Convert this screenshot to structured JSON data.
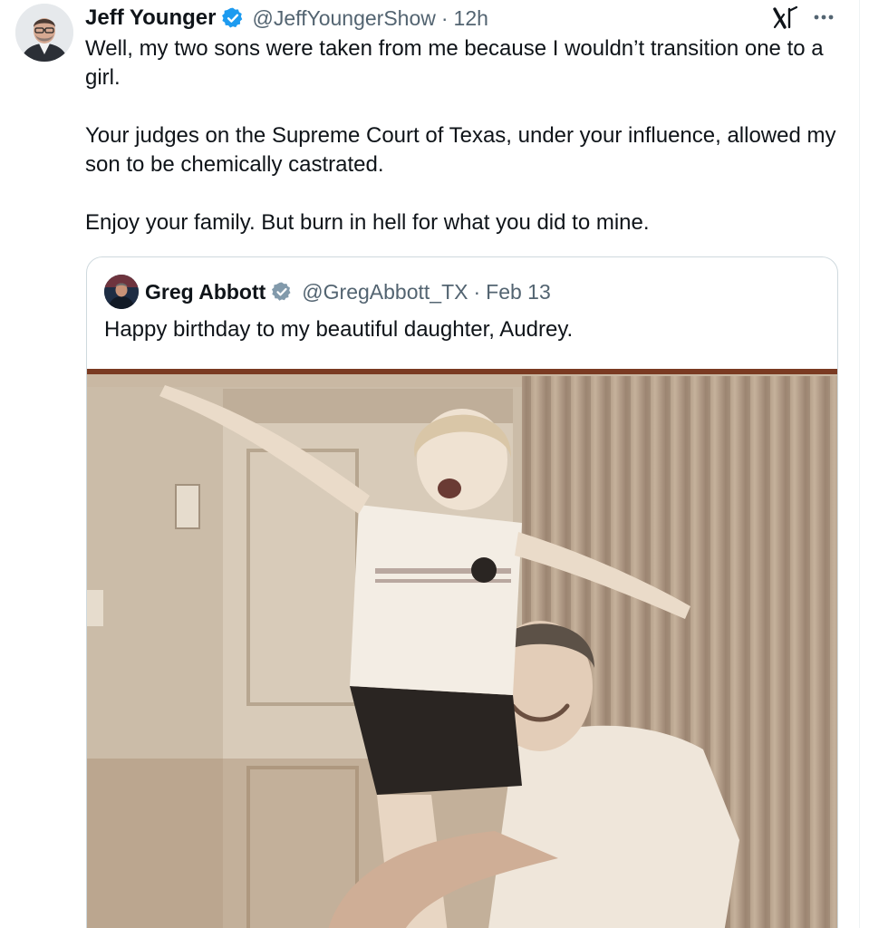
{
  "tweet": {
    "author_name": "Jeff Younger",
    "handle": "@JeffYoungerShow",
    "separator": "·",
    "time": "12h",
    "paragraphs": [
      "Well, my two sons were taken from me because I wouldn’t transition one to a girl.",
      "Your judges on the Supreme Court of Texas, under your influence, allowed my son to be chemically castrated.",
      "Enjoy your family. But burn in hell for what you did to mine."
    ],
    "icons": {
      "verified": "verified-badge-icon",
      "platform": "x-logo-icon",
      "menu": "more-options-icon"
    }
  },
  "quoted_tweet": {
    "author_name": "Greg Abbott",
    "handle": "@GregAbbott_TX",
    "separator": "·",
    "date": "Feb 13",
    "text": "Happy birthday to my beautiful daughter, Audrey.",
    "badge": "government-verified-badge-icon",
    "media": "photo"
  },
  "colors": {
    "text_primary": "#0f1419",
    "text_secondary": "#536471",
    "verified_blue": "#1d9bf0",
    "verified_gray": "#829aab",
    "border": "#cfd9de"
  }
}
